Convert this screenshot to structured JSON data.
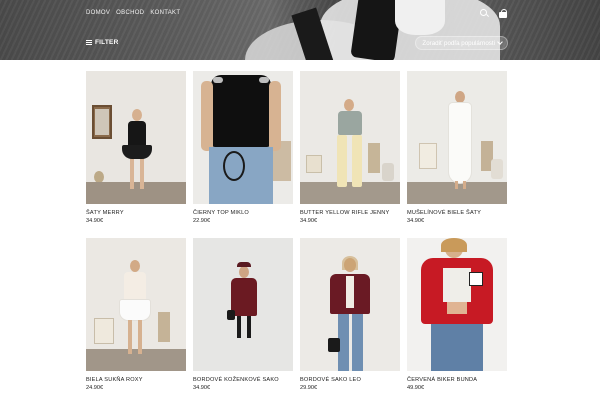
{
  "header": {
    "nav": [
      {
        "label": "DOMOV"
      },
      {
        "label": "OBCHOD"
      },
      {
        "label": "KONTAKT"
      }
    ],
    "icons": [
      "search-icon",
      "shopping-bag-icon"
    ],
    "filter_label": "FILTER",
    "sort_value": "Zoradiť podľa populárnosti"
  },
  "products": [
    {
      "name": "ŠATY MERRY",
      "price": "34.90€"
    },
    {
      "name": "ČIERNY TOP MIKLO",
      "price": "22.90€"
    },
    {
      "name": "BUTTER YELLOW RIFLE JENNY",
      "price": "34.90€"
    },
    {
      "name": "MUŠELÍNOVÉ BIELE ŠATY",
      "price": "34.90€"
    },
    {
      "name": "BIELA SUKŇA ROXY",
      "price": "24.90€"
    },
    {
      "name": "BORDOVÉ KOŽENKOVÉ SAKO",
      "price": "34.90€"
    },
    {
      "name": "BORDOVÉ SAKO LEO",
      "price": "29.90€"
    },
    {
      "name": "ČERVENÁ BIKER BUNDA",
      "price": "49.90€"
    }
  ],
  "colors": {
    "header_bg": "#555555",
    "text": "#222222",
    "white": "#ffffff"
  }
}
